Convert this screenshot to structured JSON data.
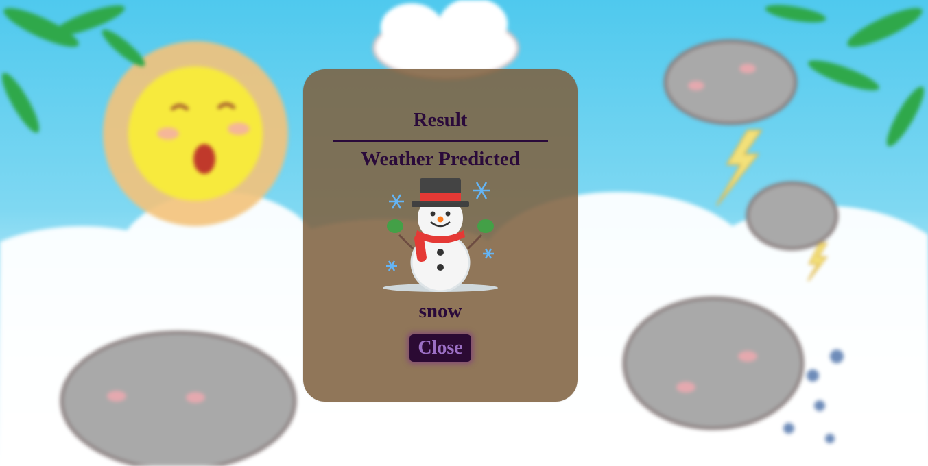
{
  "modal": {
    "title": "Result",
    "subtitle": "Weather Predicted",
    "prediction": "snow",
    "prediction_icon": "snowman-icon",
    "close_label": "Close"
  },
  "colors": {
    "modal_bg": "#7e603e",
    "text": "#2a0a3a",
    "button_bg": "#2b0a33",
    "button_text": "#9b6fc4",
    "sky": "#4fc9ee"
  },
  "background": {
    "illustration": "blurred cartoon sky with smiling sun and clouds",
    "icons": [
      "sun-icon",
      "cloud-icon",
      "lightning-icon",
      "leaf-icon"
    ]
  }
}
